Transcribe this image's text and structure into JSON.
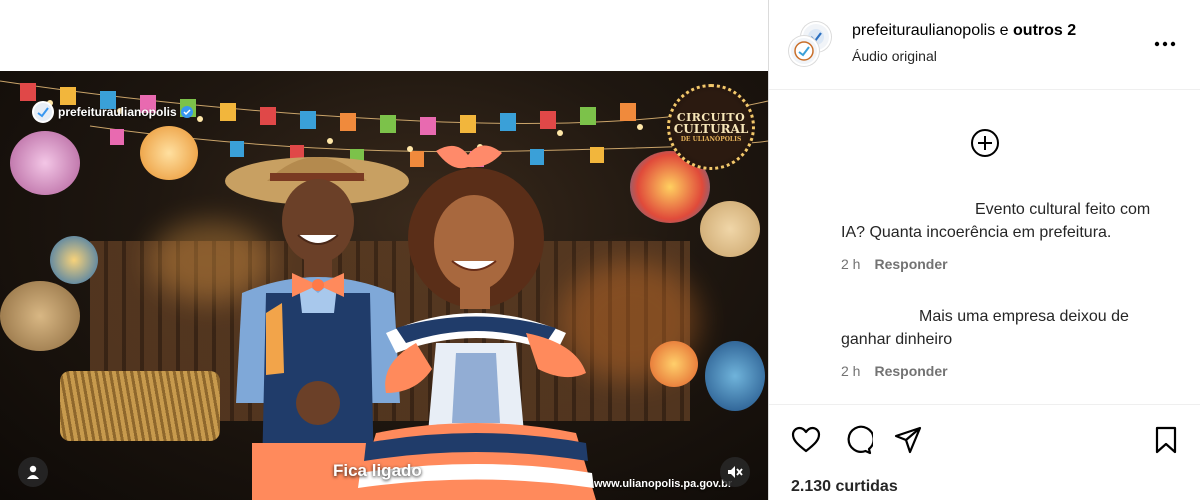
{
  "post": {
    "author": "prefeituraulianopolis",
    "connector": "e",
    "coauthors": "outros 2",
    "audio": "Áudio original",
    "likes": "2.130 curtidas"
  },
  "video": {
    "watermark_account": "prefeituraulianopolis",
    "badge": {
      "line1": "CIRCUITO",
      "line2": "CULTURAL",
      "line3": "DE ULIANÓPOLIS"
    },
    "caption": "Fica ligado",
    "url": "www.ulianopolis.pa.gov.br"
  },
  "comments": [
    {
      "text": "Evento cultural feito com IA? Quanta incoerência em prefeitura.",
      "time": "2 h",
      "reply": "Responder"
    },
    {
      "text": "Mais uma empresa deixou de ganhar dinheiro",
      "time": "2 h",
      "reply": "Responder"
    }
  ],
  "icons": {
    "more": "more-options-icon",
    "load_more": "plus-circle-icon",
    "like": "heart-icon",
    "comment": "comment-icon",
    "share": "send-icon",
    "save": "bookmark-icon",
    "user_tag": "user-icon",
    "mute": "speaker-muted-icon"
  },
  "colors": {
    "verified": "#3897f0",
    "muted_text": "#737373",
    "text": "#262626"
  }
}
